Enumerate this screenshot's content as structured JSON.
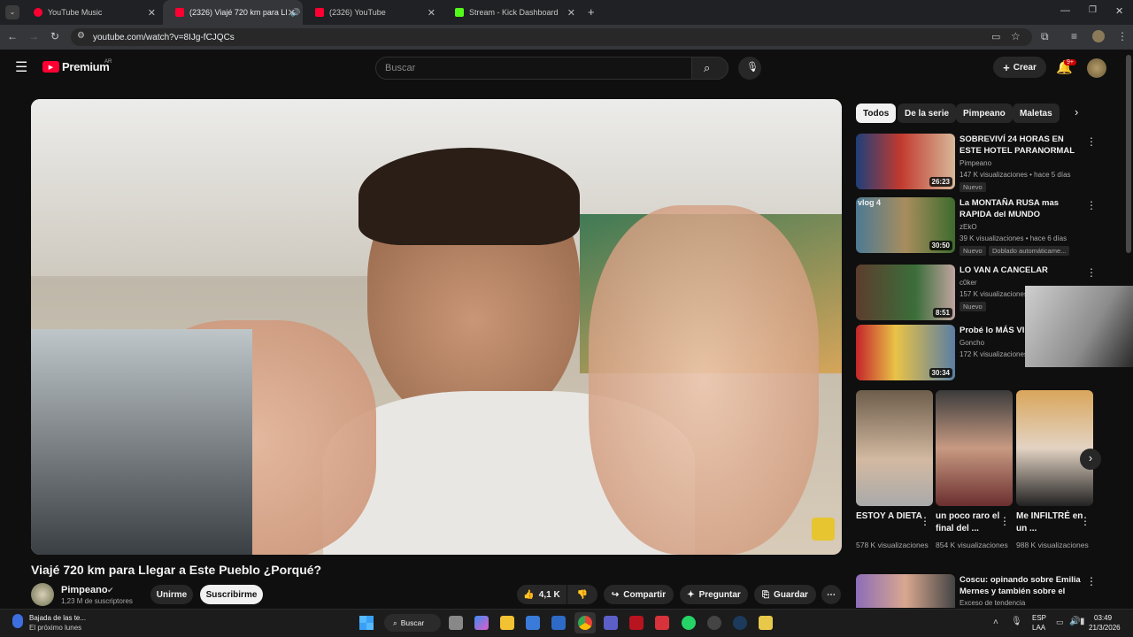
{
  "browser": {
    "tabs": [
      {
        "label": "YouTube Music",
        "color": "#ff0033"
      },
      {
        "label": "(2326) Viajé 720 km para Ll",
        "color": "#ff0033"
      },
      {
        "label": "(2326) YouTube",
        "color": "#ff0033"
      },
      {
        "label": "Stream - Kick Dashboard",
        "color": "#53fc18"
      }
    ],
    "url": "youtube.com/watch?v=8IJg-fCJQCs"
  },
  "header": {
    "logo": "Premium",
    "region": "AR",
    "search_placeholder": "Buscar",
    "create_label": "Crear",
    "notif_count": "9+"
  },
  "video": {
    "title": "Viajé 720 km para Llegar a Este Pueblo ¿Porqué?",
    "channel": "Pimpeano",
    "subscribers": "1,23 M de suscriptores",
    "join": "Unirme",
    "subscribe": "Suscribirme",
    "likes": "4,1 K",
    "share": "Compartir",
    "ask": "Preguntar",
    "save": "Guardar"
  },
  "chips": [
    "Todos",
    "De la serie",
    "Pimpeano",
    "Maletas"
  ],
  "recommendations": [
    {
      "title": "SOBREVIVÍ 24 HORAS EN ESTE HOTEL PARANORMAL",
      "channel": "Pimpeano",
      "meta": "147 K visualizaciones • hace 5 días",
      "badge": "Nuevo",
      "duration": "26:23"
    },
    {
      "title": "La MONTAÑA RUSA mas RAPIDA del MUNDO",
      "channel": "zEkO",
      "meta": "39 K visualizaciones • hace 6 días",
      "badge": "Nuevo",
      "badge2": "Doblado automáticame...",
      "duration": "30:50",
      "overlay": "vlog 4"
    },
    {
      "title": "LO VAN A CANCELAR",
      "channel": "c0ker",
      "meta": "157 K visualizaciones",
      "badge": "Nuevo",
      "duration": "8:51"
    },
    {
      "title": "Probé lo MÁS VIR",
      "channel": "Goncho",
      "meta": "172 K visualizaciones",
      "duration": "30:34"
    }
  ],
  "shorts": [
    {
      "title": "ESTOY A DIETA",
      "views": "578 K visualizaciones"
    },
    {
      "title": "un poco raro el final del ...",
      "views": "854 K visualizaciones"
    },
    {
      "title": "Me INFILTRÉ en un ...",
      "views": "988 K visualizaciones"
    }
  ],
  "last_rec": {
    "title": "Coscu: opinando sobre Emilia Mernes y también sobre el",
    "channel": "Exceso de tendencia"
  },
  "taskbar": {
    "notif_title": "Bajada de las te...",
    "notif_sub": "El próximo lunes",
    "search": "Buscar",
    "lang1": "ESP",
    "lang2": "LAA",
    "time": "03:49",
    "date": "21/3/2026"
  }
}
